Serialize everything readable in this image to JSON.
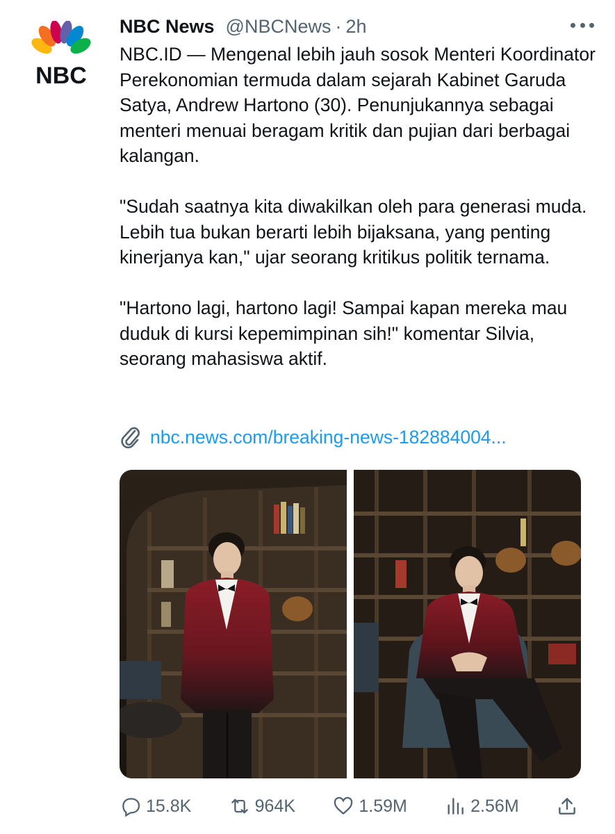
{
  "header": {
    "display_name": "NBC News",
    "handle": "@NBCNews",
    "separator": "·",
    "time": "2h"
  },
  "avatar": {
    "logo_text": "NBC",
    "icon": "nbc-peacock-logo"
  },
  "tweet": {
    "paragraphs": [
      "NBC.ID — Mengenal lebih jauh sosok Menteri Koordinator Perekonomian termuda dalam sejarah Kabinet Garuda Satya, Andrew Hartono (30). Penunjukannya sebagai menteri menuai beragam kritik dan pujian dari berbagai kalangan.",
      "\"Sudah saatnya kita diwakilkan oleh para generasi muda. Lebih tua bukan berarti lebih bijaksana, yang penting kinerjanya kan,\" ujar seorang kritikus politik ternama.",
      "\"Hartono lagi, hartono lagi! Sampai kapan mereka mau duduk di kursi kepemimpinan sih!\" komentar Silvia, seorang mahasiswa aktif."
    ],
    "link": "nbc.news.com/breaking-news-182884004..."
  },
  "actions": {
    "replies": "15.8K",
    "retweets": "964K",
    "likes": "1.59M",
    "views": "2.56M"
  },
  "colors": {
    "link": "#1d9bf0",
    "secondary_text": "#536471",
    "primary_text": "#0f1419",
    "tuxedo_red": "#7a1a22"
  }
}
